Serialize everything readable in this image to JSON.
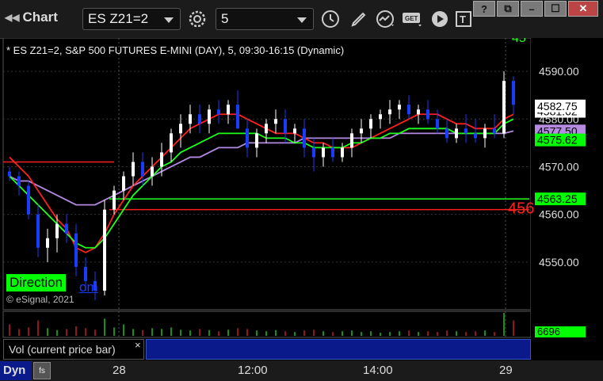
{
  "toolbar": {
    "app_title": "Chart",
    "symbol_value": "ES Z21=2",
    "interval_value": "5"
  },
  "window_buttons": [
    "?",
    "⧉",
    "–",
    "☐",
    "✕"
  ],
  "chart": {
    "description": "* ES Z21=2, S&P 500 FUTURES E-MINI (DAY), 5, 09:30-16:15 (Dynamic)",
    "direction_label": "Direction",
    "direction_tail": "om",
    "copyright": "© eSignal, 2021",
    "right_edge_label": "456",
    "top_cut_label": "45",
    "price_tags": {
      "last": "4582.75",
      "behind_last": "4581.62",
      "purple": "4577.50",
      "green_ma": "4575.62",
      "green_level": "4563.25"
    },
    "volume_tag": "6696",
    "volume_label": "Vol (current price bar)",
    "volume_close": "×",
    "bottom_left": "Dyn",
    "bottom_icon": "fs"
  },
  "chart_data": {
    "type": "candlestick",
    "ylim": [
      4540,
      4597
    ],
    "yticks": [
      "4590.00",
      "4580.00",
      "4570.00",
      "4560.00",
      "4550.00"
    ],
    "xticks": [
      "28",
      "12:00",
      "14:00",
      "29"
    ],
    "horizontal_levels": {
      "red_upper": 4571.0,
      "green": 4563.25,
      "red_lower": 4561.0
    },
    "series": [
      {
        "name": "price",
        "color": "#3355ff"
      },
      {
        "name": "red_ma",
        "color": "#ff2020"
      },
      {
        "name": "green_ma",
        "color": "#20ff20"
      },
      {
        "name": "purple_ma",
        "color": "#b58ae0"
      }
    ],
    "candles": [
      [
        4569,
        4570,
        4567,
        4568
      ],
      [
        4568,
        4569,
        4564,
        4566
      ],
      [
        4566,
        4567,
        4559,
        4560
      ],
      [
        4560,
        4562,
        4551,
        4553
      ],
      [
        4553,
        4557,
        4550,
        4555
      ],
      [
        4555,
        4560,
        4552,
        4558
      ],
      [
        4558,
        4560,
        4554,
        4556
      ],
      [
        4556,
        4558,
        4547,
        4549
      ],
      [
        4549,
        4551,
        4544,
        4546
      ],
      [
        4546,
        4548,
        4542,
        4544
      ],
      [
        4544,
        4563,
        4543,
        4561
      ],
      [
        4561,
        4566,
        4560,
        4565
      ],
      [
        4565,
        4569,
        4563,
        4568
      ],
      [
        4568,
        4573,
        4566,
        4571
      ],
      [
        4571,
        4573,
        4566,
        4568
      ],
      [
        4568,
        4572,
        4566,
        4570
      ],
      [
        4570,
        4575,
        4568,
        4573
      ],
      [
        4573,
        4578,
        4571,
        4577
      ],
      [
        4577,
        4581,
        4574,
        4579
      ],
      [
        4579,
        4583,
        4577,
        4581
      ],
      [
        4581,
        4583,
        4577,
        4579
      ],
      [
        4579,
        4583,
        4577,
        4582
      ],
      [
        4582,
        4584,
        4579,
        4581
      ],
      [
        4581,
        4584,
        4579,
        4583
      ],
      [
        4583,
        4586,
        4580,
        4578
      ],
      [
        4578,
        4580,
        4572,
        4574
      ],
      [
        4574,
        4578,
        4572,
        4577
      ],
      [
        4577,
        4580,
        4575,
        4579
      ],
      [
        4579,
        4582,
        4577,
        4580
      ],
      [
        4580,
        4582,
        4575,
        4577
      ],
      [
        4577,
        4579,
        4575,
        4578
      ],
      [
        4578,
        4580,
        4572,
        4574
      ],
      [
        4574,
        4576,
        4569,
        4572
      ],
      [
        4572,
        4575,
        4570,
        4574
      ],
      [
        4574,
        4576,
        4571,
        4572
      ],
      [
        4572,
        4575,
        4571,
        4574
      ],
      [
        4574,
        4578,
        4572,
        4577
      ],
      [
        4577,
        4580,
        4575,
        4578
      ],
      [
        4578,
        4581,
        4576,
        4580
      ],
      [
        4580,
        4582,
        4578,
        4581
      ],
      [
        4581,
        4584,
        4579,
        4582
      ],
      [
        4582,
        4584,
        4580,
        4583
      ],
      [
        4583,
        4585,
        4580,
        4581
      ],
      [
        4581,
        4583,
        4579,
        4582
      ],
      [
        4582,
        4584,
        4579,
        4580
      ],
      [
        4580,
        4582,
        4577,
        4578
      ],
      [
        4578,
        4580,
        4575,
        4576
      ],
      [
        4576,
        4579,
        4575,
        4578
      ],
      [
        4578,
        4581,
        4575,
        4577
      ],
      [
        4577,
        4580,
        4575,
        4576
      ],
      [
        4576,
        4579,
        4574,
        4578
      ],
      [
        4578,
        4581,
        4576,
        4577
      ],
      [
        4577,
        4590,
        4576,
        4588
      ],
      [
        4588,
        4589,
        4581,
        4583
      ]
    ],
    "red_ma": [
      4572,
      4570,
      4568,
      4565,
      4562,
      4559,
      4557,
      4553,
      4552,
      4553,
      4556,
      4560,
      4563,
      4566,
      4568,
      4570,
      4572,
      4574,
      4576,
      4578,
      4579,
      4580,
      4581,
      4581,
      4581,
      4580,
      4579,
      4578,
      4577,
      4577,
      4577,
      4576,
      4575,
      4575,
      4574,
      4574,
      4574,
      4575,
      4576,
      4577,
      4578,
      4579,
      4580,
      4581,
      4581,
      4581,
      4580,
      4579,
      4579,
      4578,
      4578,
      4578,
      4580,
      4581
    ],
    "green_ma": [
      4568,
      4566,
      4564,
      4562,
      4560,
      4558,
      4556,
      4554,
      4553,
      4553,
      4555,
      4558,
      4561,
      4564,
      4566,
      4568,
      4570,
      4571,
      4573,
      4574,
      4575,
      4576,
      4577,
      4577,
      4577,
      4577,
      4577,
      4576,
      4576,
      4576,
      4575,
      4575,
      4574,
      4574,
      4574,
      4574,
      4575,
      4575,
      4576,
      4576,
      4577,
      4577,
      4578,
      4578,
      4578,
      4578,
      4578,
      4577,
      4577,
      4577,
      4577,
      4577,
      4579,
      4580
    ],
    "purple_ma": [
      4568,
      4567,
      4567,
      4566,
      4565,
      4564,
      4563,
      4562,
      4562,
      4562,
      4563,
      4564,
      4565,
      4566,
      4567,
      4568,
      4569,
      4570,
      4571,
      4572,
      4572,
      4573,
      4574,
      4574,
      4574,
      4575,
      4575,
      4575,
      4575,
      4575,
      4575,
      4576,
      4576,
      4576,
      4576,
      4576,
      4576,
      4576,
      4576,
      4576,
      4576,
      4577,
      4577,
      4577,
      4577,
      4577,
      4577,
      4577,
      4577,
      4577,
      4577,
      4577,
      4577,
      4577.5
    ],
    "volume": [
      30,
      18,
      22,
      40,
      20,
      15,
      18,
      25,
      20,
      16,
      45,
      22,
      30,
      18,
      15,
      20,
      18,
      22,
      16,
      14,
      18,
      15,
      12,
      16,
      20,
      18,
      14,
      12,
      15,
      12,
      10,
      14,
      16,
      12,
      10,
      12,
      14,
      10,
      12,
      8,
      10,
      12,
      14,
      10,
      12,
      10,
      14,
      12,
      10,
      12,
      14,
      10,
      60,
      40
    ]
  },
  "colors": {
    "bull": "#ffffff",
    "bear": "#1a3cff",
    "grid": "#333333",
    "tag_white": "#ffffff",
    "tag_green": "#00ff00",
    "tag_purple": "#b58ae0",
    "vol_blue": "#0a1a8a"
  }
}
